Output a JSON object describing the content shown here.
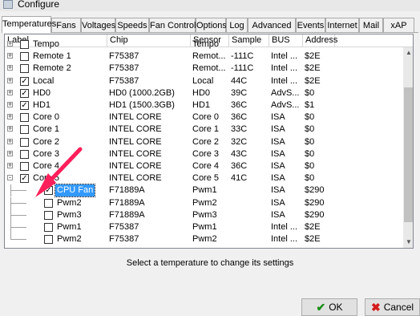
{
  "window": {
    "title": "Configure"
  },
  "tabs": [
    {
      "label": "Temperatures",
      "active": true
    },
    {
      "label": "Fans"
    },
    {
      "label": "Voltages"
    },
    {
      "label": "Speeds"
    },
    {
      "label": "Fan Control"
    },
    {
      "label": "Options"
    },
    {
      "label": "Log"
    },
    {
      "label": "Advanced"
    },
    {
      "label": "Events"
    },
    {
      "label": "Internet"
    },
    {
      "label": "Mail"
    },
    {
      "label": "xAP"
    }
  ],
  "columns": [
    "Label",
    "Chip",
    "Sensor",
    "Sample",
    "BUS",
    "Address"
  ],
  "rows": [
    {
      "label": "Tempo",
      "chip": "",
      "sensor": "Tempo",
      "sample": "",
      "bus": "",
      "address": "",
      "expander": "+",
      "checked": false,
      "level": 0
    },
    {
      "label": "Remote 1",
      "chip": "F75387",
      "sensor": "Remot...",
      "sample": "-111C",
      "bus": "Intel ...",
      "address": "$2E",
      "expander": "+",
      "checked": false,
      "level": 0
    },
    {
      "label": "Remote 2",
      "chip": "F75387",
      "sensor": "Remot...",
      "sample": "-111C",
      "bus": "Intel ...",
      "address": "$2E",
      "expander": "+",
      "checked": false,
      "level": 0
    },
    {
      "label": "Local",
      "chip": "F75387",
      "sensor": "Local",
      "sample": "44C",
      "bus": "Intel ...",
      "address": "$2E",
      "expander": "+",
      "checked": true,
      "level": 0
    },
    {
      "label": "HD0",
      "chip": "HD0 (1000.2GB)",
      "sensor": "HD0",
      "sample": "39C",
      "bus": "AdvS...",
      "address": "$0",
      "expander": "+",
      "checked": true,
      "level": 0
    },
    {
      "label": "HD1",
      "chip": "HD1 (1500.3GB)",
      "sensor": "HD1",
      "sample": "36C",
      "bus": "AdvS...",
      "address": "$1",
      "expander": "+",
      "checked": true,
      "level": 0
    },
    {
      "label": "Core 0",
      "chip": "INTEL CORE",
      "sensor": "Core 0",
      "sample": "36C",
      "bus": "ISA",
      "address": "$0",
      "expander": "+",
      "checked": false,
      "level": 0
    },
    {
      "label": "Core 1",
      "chip": "INTEL CORE",
      "sensor": "Core 1",
      "sample": "33C",
      "bus": "ISA",
      "address": "$0",
      "expander": "+",
      "checked": false,
      "level": 0
    },
    {
      "label": "Core 2",
      "chip": "INTEL CORE",
      "sensor": "Core 2",
      "sample": "32C",
      "bus": "ISA",
      "address": "$0",
      "expander": "+",
      "checked": false,
      "level": 0
    },
    {
      "label": "Core 3",
      "chip": "INTEL CORE",
      "sensor": "Core 3",
      "sample": "43C",
      "bus": "ISA",
      "address": "$0",
      "expander": "+",
      "checked": false,
      "level": 0
    },
    {
      "label": "Core 4",
      "chip": "INTEL CORE",
      "sensor": "Core 4",
      "sample": "36C",
      "bus": "ISA",
      "address": "$0",
      "expander": "+",
      "checked": false,
      "level": 0
    },
    {
      "label": "Core 5",
      "chip": "INTEL CORE",
      "sensor": "Core 5",
      "sample": "41C",
      "bus": "ISA",
      "address": "$0",
      "expander": "-",
      "checked": true,
      "level": 0
    },
    {
      "label": "CPU Fan",
      "chip": "F71889A",
      "sensor": "Pwm1",
      "sample": "",
      "bus": "ISA",
      "address": "$290",
      "expander": "",
      "checked": true,
      "level": 1,
      "selected": true
    },
    {
      "label": "Pwm2",
      "chip": "F71889A",
      "sensor": "Pwm2",
      "sample": "",
      "bus": "ISA",
      "address": "$290",
      "expander": "",
      "checked": false,
      "level": 1
    },
    {
      "label": "Pwm3",
      "chip": "F71889A",
      "sensor": "Pwm3",
      "sample": "",
      "bus": "ISA",
      "address": "$290",
      "expander": "",
      "checked": false,
      "level": 1
    },
    {
      "label": "Pwm1",
      "chip": "F75387",
      "sensor": "Pwm1",
      "sample": "",
      "bus": "Intel ...",
      "address": "$2E",
      "expander": "",
      "checked": false,
      "level": 1
    },
    {
      "label": "Pwm2",
      "chip": "F75387",
      "sensor": "Pwm2",
      "sample": "",
      "bus": "Intel ...",
      "address": "$2E",
      "expander": "",
      "checked": false,
      "level": 1
    }
  ],
  "status_text": "Select a temperature to change its settings",
  "buttons": {
    "ok": "OK",
    "cancel": "Cancel"
  },
  "colors": {
    "selection": "#3399ff",
    "arrow": "#ff1f5a",
    "ok_icon": "#1a8f1a",
    "cancel_icon": "#d41a1a"
  }
}
